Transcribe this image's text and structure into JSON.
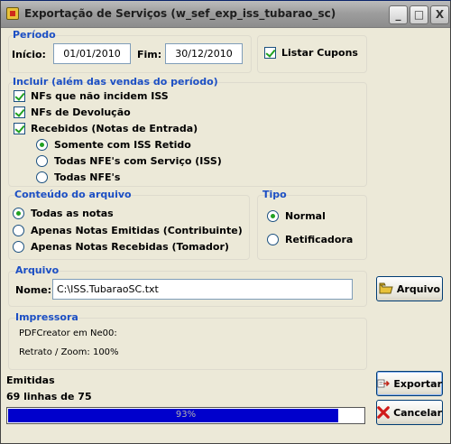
{
  "window": {
    "title": "Exportação de Serviços (w_sef_exp_iss_tubarao_sc)",
    "minimize": "_",
    "maximize": "□",
    "close": "X"
  },
  "periodo": {
    "title": "Período",
    "inicio_label": "Início:",
    "inicio_value": "01/01/2010",
    "fim_label": "Fim:",
    "fim_value": "30/12/2010",
    "listar_cupons_label": "Listar Cupons",
    "listar_cupons_checked": true
  },
  "incluir": {
    "title": "Incluir (além das vendas do período)",
    "checkboxes": [
      {
        "label": "NFs que não incidem ISS",
        "checked": true
      },
      {
        "label": "NFs de Devolução",
        "checked": true
      },
      {
        "label": "Recebidos (Notas de Entrada)",
        "checked": true
      }
    ],
    "radios": [
      {
        "label": "Somente com ISS Retido",
        "checked": true
      },
      {
        "label": "Todas NFE's com Serviço (ISS)",
        "checked": false
      },
      {
        "label": "Todas NFE's",
        "checked": false
      }
    ]
  },
  "conteudo": {
    "title": "Conteúdo do arquivo",
    "options": [
      {
        "label": "Todas as notas",
        "checked": true
      },
      {
        "label": "Apenas Notas Emitidas (Contribuinte)",
        "checked": false
      },
      {
        "label": "Apenas Notas Recebidas (Tomador)",
        "checked": false
      }
    ]
  },
  "tipo": {
    "title": "Tipo",
    "options": [
      {
        "label": "Normal",
        "checked": true
      },
      {
        "label": "Retificadora",
        "checked": false
      }
    ]
  },
  "arquivo": {
    "title": "Arquivo",
    "nome_label": "Nome:",
    "nome_value": "C:\\ISS.TubaraoSC.txt",
    "button_label": "Arquivo",
    "button_icon": "folder-icon"
  },
  "impressora": {
    "title": "Impressora",
    "printer": "PDFCreator em Ne00:",
    "retrato": "Retrato / Zoom: 100%"
  },
  "status": {
    "emitidas_label": "Emitidas",
    "linhas": "69 linhas de 75",
    "progress_percent": 93,
    "progress_text": "93%"
  },
  "buttons": {
    "exportar": "Exportar",
    "exportar_icon": "export-icon",
    "cancelar": "Cancelar",
    "cancelar_icon": "red-x-icon"
  },
  "colors": {
    "group_title": "#1c4fc4",
    "check": "#21a121",
    "progress": "#0000cc"
  }
}
